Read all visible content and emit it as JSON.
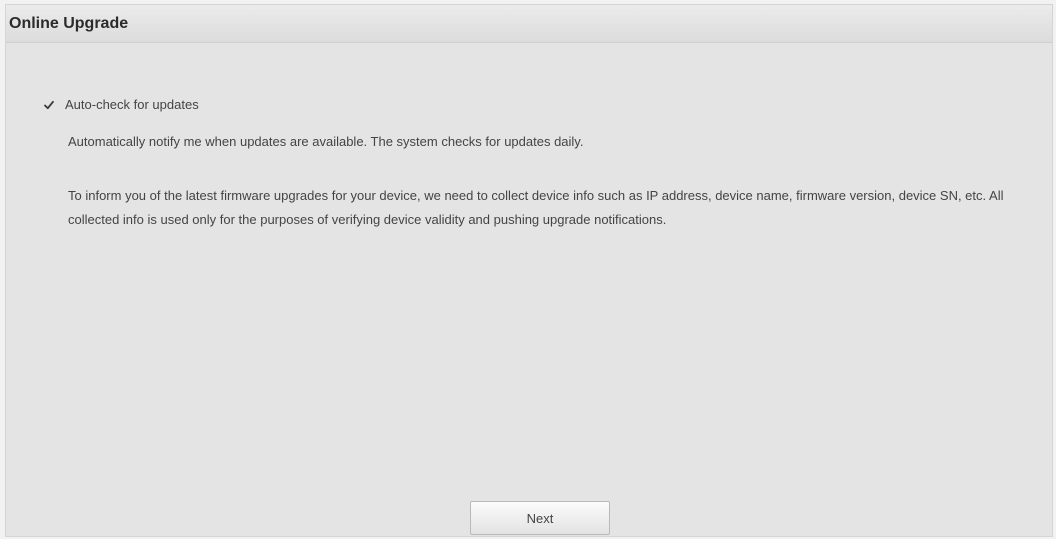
{
  "dialog": {
    "title": "Online Upgrade"
  },
  "auto_check": {
    "label": "Auto-check for updates",
    "checked": true,
    "icon": "checkmark-icon"
  },
  "note": "Automatically notify me when updates are available. The system checks for updates daily.",
  "privacy_text": "To inform you of the latest firmware upgrades for your device, we need to collect device info such as IP address, device name, firmware version, device SN, etc. All collected info is used only for the purposes of verifying device validity and pushing upgrade notifications.",
  "buttons": {
    "next_label": "Next"
  }
}
